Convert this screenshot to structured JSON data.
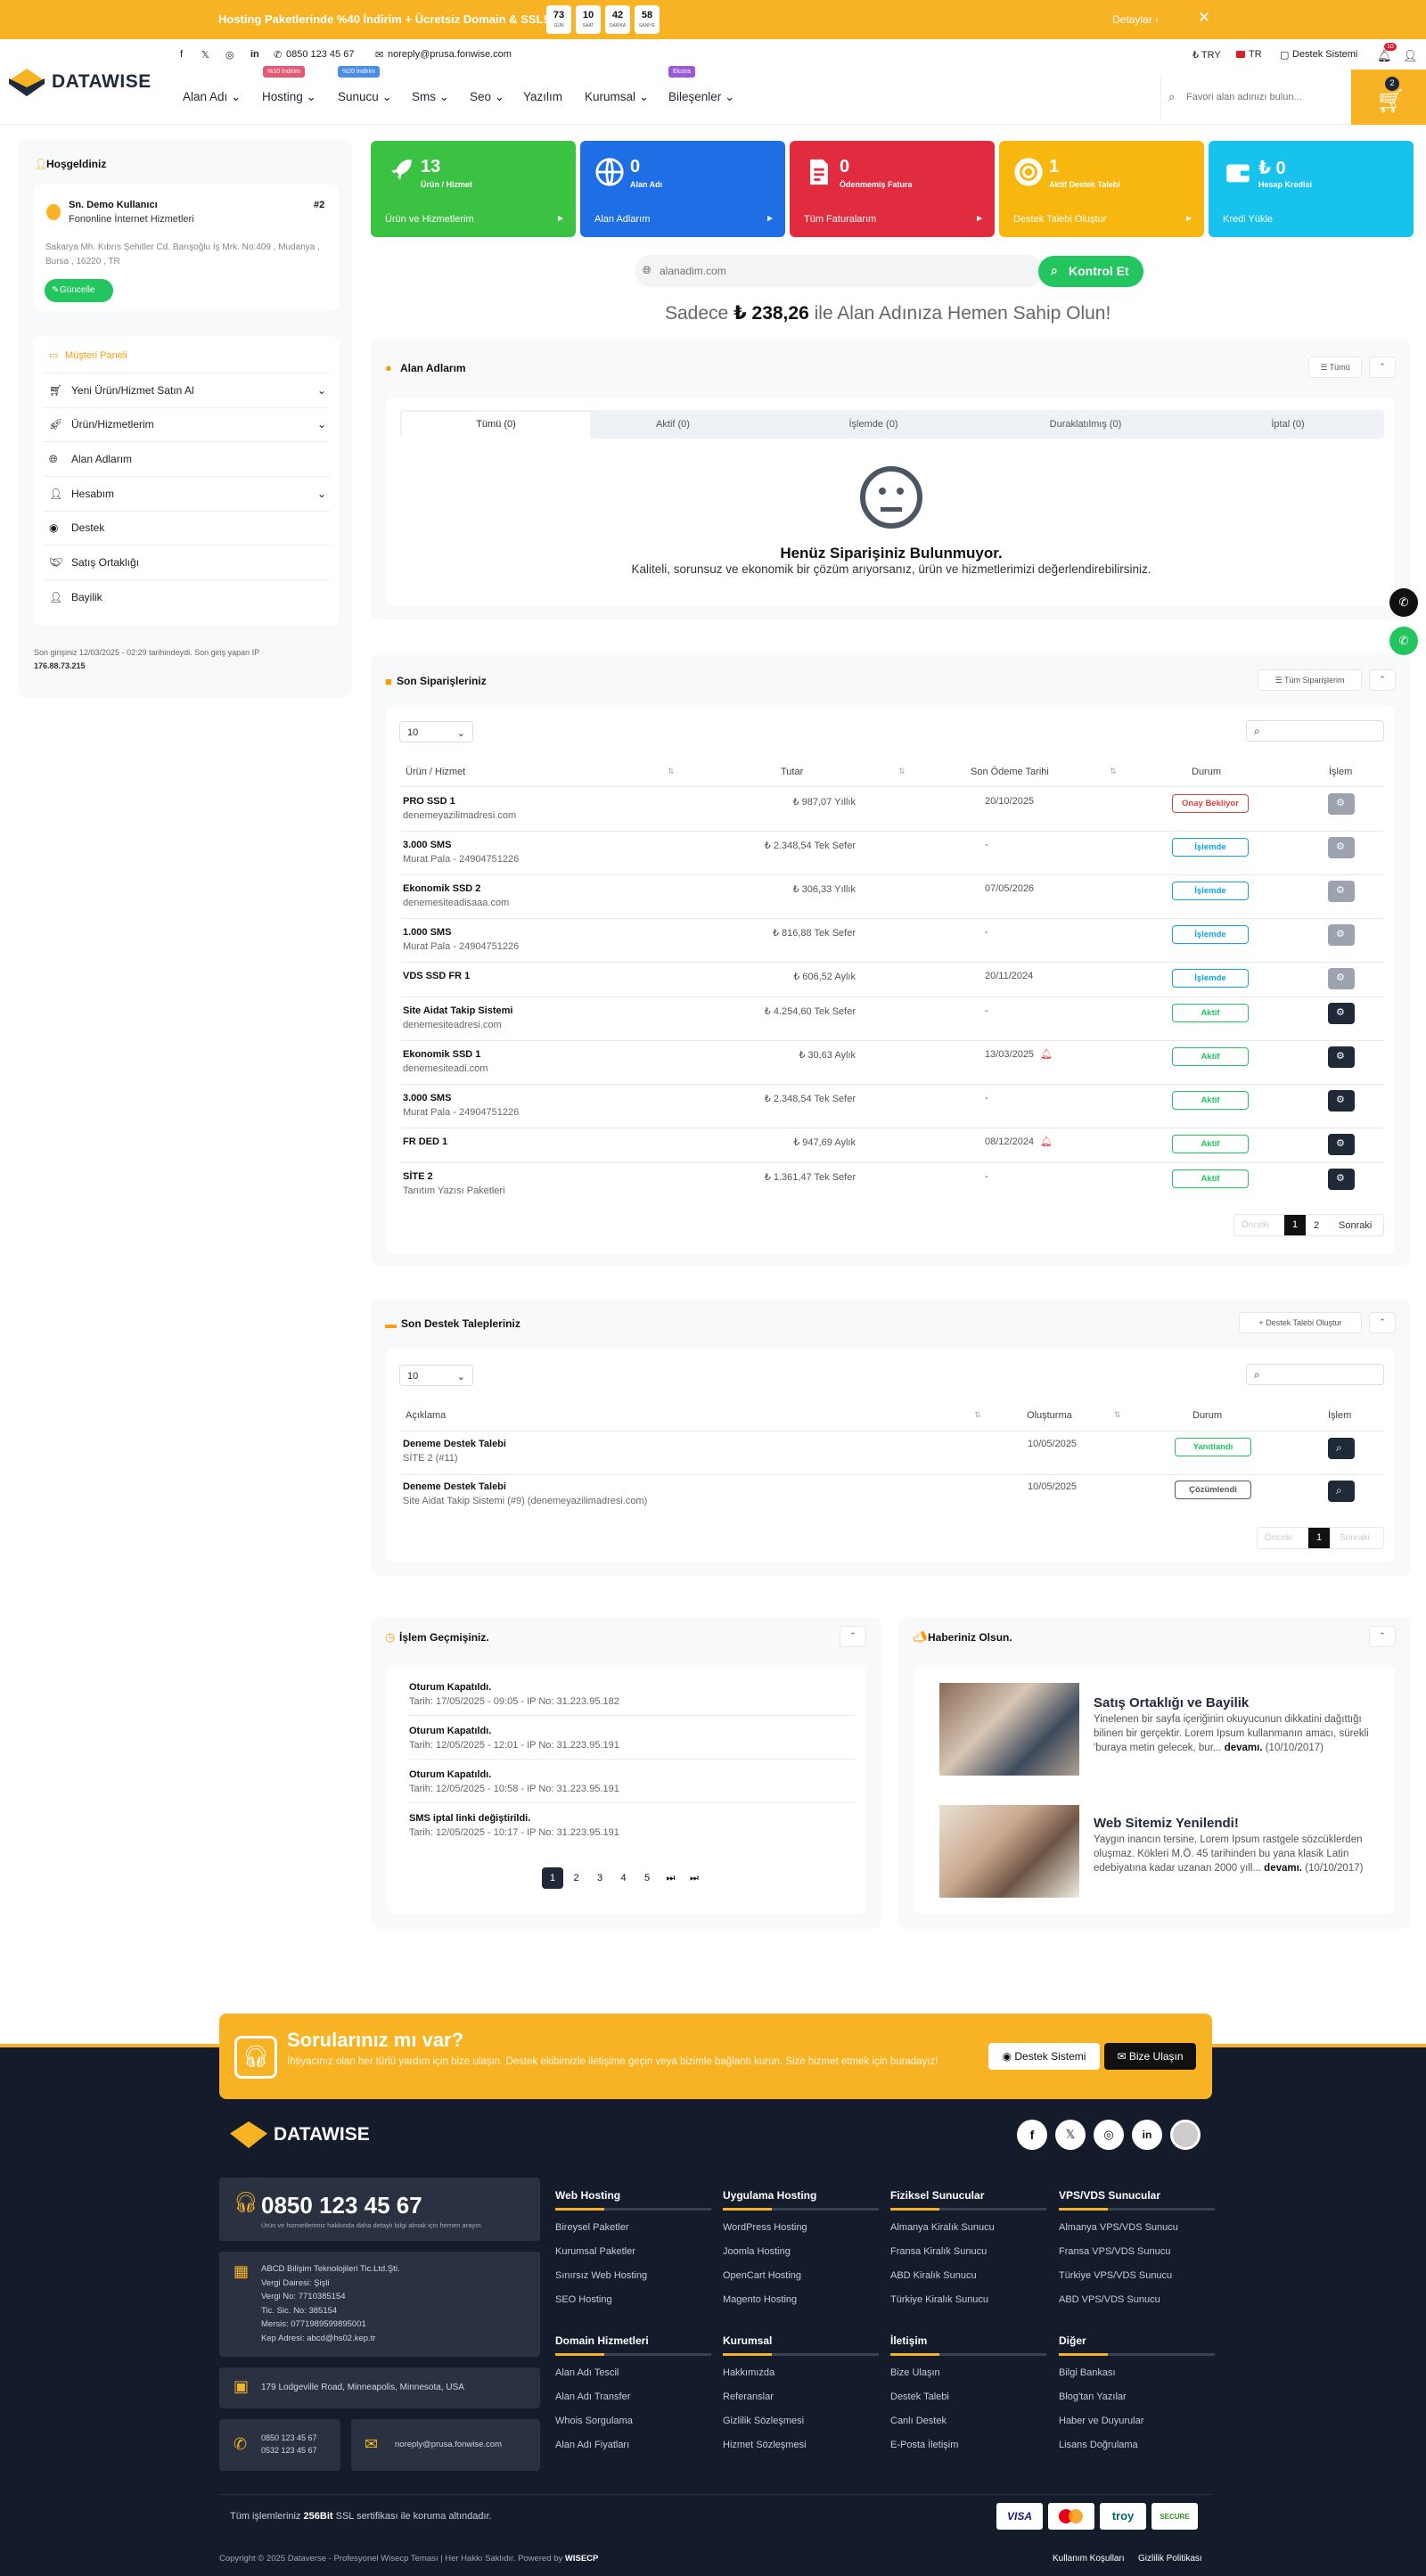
{
  "topbar": {
    "message": "Hosting Paketlerinde %40 İndirim + Ücretsiz Domain & SSL!",
    "countdown": [
      {
        "v": "73",
        "l": "GÜN"
      },
      {
        "v": "10",
        "l": "SAAT"
      },
      {
        "v": "42",
        "l": "DAKİKA"
      },
      {
        "v": "58",
        "l": "SANİYE"
      }
    ],
    "details": "Detaylar ›",
    "close": "✕"
  },
  "header": {
    "brand": "DATAWISE",
    "phone": "0850 123 45 67",
    "email": "noreply@prusa.fonwise.com",
    "currency": "₺ TRY",
    "lang": "TR",
    "support": "Destek Sistemi",
    "notif_count": "10",
    "cart_count": "2",
    "search_placeholder": "Favori alan adınızı bulun...",
    "nav": [
      {
        "label": "Alan Adı ⌄",
        "badge": ""
      },
      {
        "label": "Hosting ⌄",
        "badge": "%10 İndirim"
      },
      {
        "label": "Sunucu ⌄",
        "badge": "%20 İndirim"
      },
      {
        "label": "Sms ⌄",
        "badge": ""
      },
      {
        "label": "Seo ⌄",
        "badge": ""
      },
      {
        "label": "Yazılım",
        "badge": ""
      },
      {
        "label": "Kurumsal ⌄",
        "badge": ""
      },
      {
        "label": "Bileşenler ⌄",
        "badge": "Ekstra"
      }
    ]
  },
  "sidebar": {
    "welcome": "Hoşgeldiniz",
    "user_name": "Sn. Demo Kullanıcı",
    "user_rank": "#2",
    "company": "Fononline İnternet Hizmetleri",
    "address": "Sakarya Mh. Kıbrıs Şehitler Cd. Barışoğlu İş Mrk. No:409 , Mudanya , Bursa , 16220 , TR",
    "update": "Güncelle",
    "panel_title": "Müşteri Paneli",
    "menu": [
      "Yeni Ürün/Hizmet Satın Al",
      "Ürün/Hizmetlerim",
      "Alan Adlarım",
      "Hesabım",
      "Destek",
      "Satış Ortaklığı",
      "Bayilik"
    ],
    "last_login": "Son girişiniz 12/03/2025 - 02:29 tarihindeydi. Son giriş yapan IP",
    "last_ip": "176.88.73.215"
  },
  "stats": [
    {
      "num": "13",
      "label": "Ürün / Hizmet",
      "foot": "Ürün ve Hizmetlerim",
      "color": "#3cc243"
    },
    {
      "num": "0",
      "label": "Alan Adı",
      "foot": "Alan Adlarım",
      "color": "#1e6ee6"
    },
    {
      "num": "0",
      "label": "Ödenmemiş Fatura",
      "foot": "Tüm Faturalarım",
      "color": "#e12c3f"
    },
    {
      "num": "1",
      "label": "Aktif Destek Talebi",
      "foot": "Destek Talebi Oluştur",
      "color": "#f8b70e"
    },
    {
      "num": "₺ 0",
      "label": "Hesap Kredisi",
      "foot": "Kredi Yükle",
      "color": "#17c3ec"
    }
  ],
  "domain": {
    "placeholder": "alanadim.com",
    "button": "Kontrol Et",
    "promo_pre": "Sadece",
    "promo_price": "₺ 238,26",
    "promo_post": "ile Alan Adınıza Hemen Sahip Olun!"
  },
  "domains_section": {
    "title": "Alan Adlarım",
    "filter": "Tümü",
    "tabs": [
      "Tümü (0)",
      "Aktif (0)",
      "İşlemde (0)",
      "Duraklatılmış (0)",
      "İptal (0)"
    ],
    "empty_title": "Henüz Siparişiniz Bulunmuyor.",
    "empty_text": "Kaliteli, sorunsuz ve ekonomik bir çözüm arıyorsanız, ürün ve hizmetlerimizi değerlendirebilirsiniz."
  },
  "orders": {
    "title": "Son Siparişleriniz",
    "all_btn": "Tüm Siparişlerim",
    "page_size": "10",
    "headers": [
      "Ürün / Hizmet",
      "Tutar",
      "Son Ödeme Tarihi",
      "Durum",
      "İşlem"
    ],
    "rows": [
      {
        "name": "PRO SSD 1",
        "sub": "denemeyazilimadresi.com",
        "amount": "₺ 987,07 Yıllık",
        "date": "20/10/2025",
        "status": "Onay Bekliyor",
        "sc": "#e43d3d",
        "dark": false,
        "bell": false
      },
      {
        "name": "3.000 SMS",
        "sub": "Murat Pala - 24904751226",
        "amount": "₺ 2.348,54 Tek Sefer",
        "date": "-",
        "status": "İşlemde",
        "sc": "#0ea5e9",
        "dark": false,
        "bell": false
      },
      {
        "name": "Ekonomik SSD 2",
        "sub": "denemesiteadisaaa.com",
        "amount": "₺ 306,33 Yıllık",
        "date": "07/05/2026",
        "status": "İşlemde",
        "sc": "#0ea5e9",
        "dark": false,
        "bell": false
      },
      {
        "name": "1.000 SMS",
        "sub": "Murat Pala - 24904751226",
        "amount": "₺ 816,88 Tek Sefer",
        "date": "-",
        "status": "İşlemde",
        "sc": "#0ea5e9",
        "dark": false,
        "bell": false
      },
      {
        "name": "VDS SSD FR 1",
        "sub": "",
        "amount": "₺ 606,52 Aylık",
        "date": "20/11/2024",
        "status": "İşlemde",
        "sc": "#0ea5e9",
        "dark": false,
        "bell": false
      },
      {
        "name": "Site Aidat Takip Sistemi",
        "sub": "denemesiteadresi.com",
        "amount": "₺ 4.254,60 Tek Sefer",
        "date": "-",
        "status": "Aktif",
        "sc": "#22c55e",
        "dark": true,
        "bell": false
      },
      {
        "name": "Ekonomik SSD 1",
        "sub": "denemesiteadi.com",
        "amount": "₺ 30,63 Aylık",
        "date": "13/03/2025",
        "status": "Aktif",
        "sc": "#22c55e",
        "dark": true,
        "bell": true
      },
      {
        "name": "3.000 SMS",
        "sub": "Murat Pala - 24904751226",
        "amount": "₺ 2.348,54 Tek Sefer",
        "date": "-",
        "status": "Aktif",
        "sc": "#22c55e",
        "dark": true,
        "bell": false
      },
      {
        "name": "FR DED 1",
        "sub": "",
        "amount": "₺ 947,69 Aylık",
        "date": "08/12/2024",
        "status": "Aktif",
        "sc": "#22c55e",
        "dark": true,
        "bell": true
      },
      {
        "name": "SİTE 2",
        "sub": "Tanıtım Yazısı Paketleri",
        "amount": "₺ 1.361,47 Tek Sefer",
        "date": "-",
        "status": "Aktif",
        "sc": "#22c55e",
        "dark": true,
        "bell": false
      }
    ],
    "pager": {
      "prev": "Önceki",
      "p1": "1",
      "p2": "2",
      "next": "Sonraki"
    }
  },
  "tickets": {
    "title": "Son Destek Talepleriniz",
    "create_btn": "Destek Talebi Oluştur",
    "page_size": "10",
    "headers": [
      "Açıklama",
      "Oluşturma",
      "Durum",
      "İşlem"
    ],
    "rows": [
      {
        "name": "Deneme Destek Talebi",
        "sub": "SİTE 2 (#11)",
        "date": "10/05/2025",
        "status": "Yanıtlandı",
        "sc": "#22c55e"
      },
      {
        "name": "Deneme Destek Talebi",
        "sub": "Site Aidat Takip Sistemi (#9) (denemeyazilimadresi.com)",
        "date": "10/05/2025",
        "status": "Çözümlendi",
        "sc": "#555"
      }
    ],
    "pager": {
      "prev": "Önceki",
      "p1": "1",
      "next": "Sonraki"
    }
  },
  "history": {
    "title": "İşlem Geçmişiniz.",
    "items": [
      {
        "t": "Oturum Kapatıldı.",
        "d": "Tarih: 17/05/2025 - 09:05 - IP No: 31.223.95.182"
      },
      {
        "t": "Oturum Kapatıldı.",
        "d": "Tarih: 12/05/2025 - 12:01 - IP No: 31.223.95.191"
      },
      {
        "t": "Oturum Kapatıldı.",
        "d": "Tarih: 12/05/2025 - 10:58 - IP No: 31.223.95.191"
      },
      {
        "t": "SMS iptal linki değiştirildi.",
        "d": "Tarih: 12/05/2025 - 10:17 - IP No: 31.223.95.191"
      }
    ],
    "pages": [
      "1",
      "2",
      "3",
      "4",
      "5",
      "⏭",
      "⏭"
    ]
  },
  "news": {
    "title": "Haberiniz Olsun.",
    "items": [
      {
        "t": "Satış Ortaklığı ve Bayilik",
        "d": "Yinelenen bir sayfa içeriğinin okuyucunun dikkatini dağıttığı bilinen bir gerçektir. Lorem Ipsum kullanmanın amacı, sürekli 'buraya metin gelecek, bur...",
        "more": "devamı.",
        "date": "(10/10/2017)"
      },
      {
        "t": "Web Sitemiz Yenilendi!",
        "d": "Yaygın inancın tersine, Lorem Ipsum rastgele sözcüklerden oluşmaz. Kökleri M.Ö. 45 tarihinden bu yana klasik Latin edebiyatına kadar uzanan 2000 yıll...",
        "more": "devamı.",
        "date": "(10/10/2017)"
      }
    ]
  },
  "cta": {
    "title": "Sorularınız mı var?",
    "text": "İhtiyacınız olan her türlü yardım için bize ulaşın. Destek ekibimizle iletişime geçin veya bizimle bağlantı kurun. Size hizmet etmek için buradayız!",
    "btn1": "Destek Sistemi",
    "btn2": "Bize Ulaşın"
  },
  "footer": {
    "brand": "DATAWISE",
    "phone": "0850 123 45 67",
    "phone_sub": "Ürün ve hizmetlerimiz hakkında daha detaylı bilgi almak için hemen arayın.",
    "company": [
      "ABCD Bilişim Teknolojileri Tic.Ltd.Şti.",
      "Vergi Dairesi: Şişli",
      "Vergi No: 7710385154",
      "Tic. Sic. No: 385154",
      "Mersis: 0771989599895001",
      "Kep Adresi: abcd@hs02.kep.tr"
    ],
    "address": "179 Lodgeville Road, Minneapolis, Minnesota, USA",
    "phones": [
      "0850 123 45 67",
      "0532 123 45 67"
    ],
    "email": "noreply@prusa.fonwise.com",
    "cols": [
      {
        "h": "Web Hosting",
        "l": [
          "Bireysel Paketler",
          "Kurumsal Paketler",
          "Sınırsız Web Hosting",
          "SEO Hosting"
        ]
      },
      {
        "h": "Uygulama Hosting",
        "l": [
          "WordPress Hosting",
          "Joomla Hosting",
          "OpenCart Hosting",
          "Magento Hosting"
        ]
      },
      {
        "h": "Fiziksel Sunucular",
        "l": [
          "Almanya Kiralık Sunucu",
          "Fransa Kiralık Sunucu",
          "ABD Kiralık Sunucu",
          "Türkiye Kiralık Sunucu"
        ]
      },
      {
        "h": "VPS/VDS Sunucular",
        "l": [
          "Almanya VPS/VDS Sunucu",
          "Fransa VPS/VDS Sunucu",
          "Türkiye VPS/VDS Sunucu",
          "ABD VPS/VDS Sunucu"
        ]
      },
      {
        "h": "Domain Hizmetleri",
        "l": [
          "Alan Adı Tescil",
          "Alan Adı Transfer",
          "Whois Sorgulama",
          "Alan Adı Fiyatları"
        ]
      },
      {
        "h": "Kurumsal",
        "l": [
          "Hakkımızda",
          "Referanslar",
          "Gizlilik Sözleşmesi",
          "Hizmet Sözleşmesi"
        ]
      },
      {
        "h": "İletişim",
        "l": [
          "Bize Ulaşın",
          "Destek Talebi",
          "Canlı Destek",
          "E-Posta İletişim"
        ]
      },
      {
        "h": "Diğer",
        "l": [
          "Bilgi Bankası",
          "Blog'tan Yazılar",
          "Haber ve Duyurular",
          "Lisans Doğrulama"
        ]
      }
    ],
    "ssl_pre": "Tüm işlemleriniz",
    "ssl_b": "256Bit",
    "ssl_post": "SSL sertifikası ile koruma altındadır.",
    "payments": [
      "VISA",
      "MC",
      "troy",
      "SECURE"
    ],
    "copyright": "Copyright © 2025 Dataverse - Profesyonel Wisecp Teması | Her Hakkı Saklıdır. Powered by",
    "powered": "WISECP",
    "links": [
      "Kullanım Koşulları",
      "Gizlilik Politikası"
    ]
  }
}
